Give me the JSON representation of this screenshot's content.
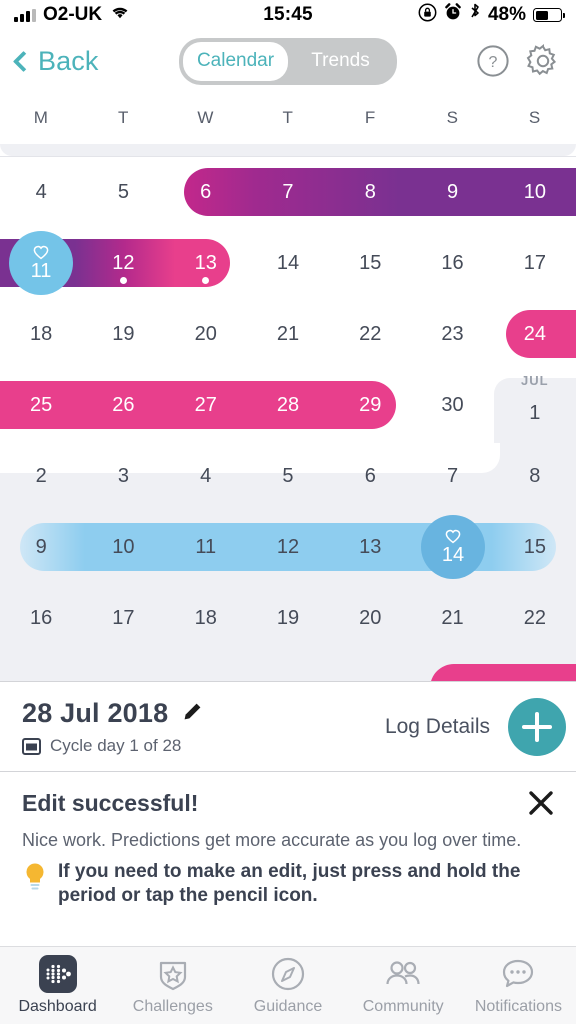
{
  "status_bar": {
    "carrier": "O2-UK",
    "time": "15:45",
    "battery_pct": "48%",
    "icons": [
      "signal-icon",
      "wifi-icon",
      "rotation-lock-icon",
      "alarm-icon",
      "bluetooth-icon",
      "battery-icon"
    ]
  },
  "header": {
    "back_label": "Back",
    "segments": [
      {
        "label": "Calendar",
        "active": true
      },
      {
        "label": "Trends",
        "active": false
      }
    ],
    "help_icon": "help-icon",
    "settings_icon": "gear-icon",
    "accent_teal": "#4cb3ba"
  },
  "calendar": {
    "weekdays": [
      "M",
      "T",
      "W",
      "T",
      "F",
      "S",
      "S"
    ],
    "colors": {
      "period_pink": "#e83f8c",
      "period_purple": "#7a3191",
      "fertile_blue": "#8ecdef",
      "ovulation_blue": "#74c4e8",
      "next_month_bg": "#eff0f4",
      "day_text": "#454b58"
    },
    "rows": [
      {
        "days": [
          {
            "num": "4"
          },
          {
            "num": "5"
          },
          {
            "num": "6"
          },
          {
            "num": "7"
          },
          {
            "num": "8"
          },
          {
            "num": "9"
          },
          {
            "num": "10"
          }
        ]
      },
      {
        "days": [
          {
            "num": "11"
          },
          {
            "num": "12"
          },
          {
            "num": "13"
          },
          {
            "num": "14"
          },
          {
            "num": "15"
          },
          {
            "num": "16"
          },
          {
            "num": "17"
          }
        ]
      },
      {
        "days": [
          {
            "num": "18"
          },
          {
            "num": "19"
          },
          {
            "num": "20"
          },
          {
            "num": "21"
          },
          {
            "num": "22"
          },
          {
            "num": "23"
          },
          {
            "num": "24"
          }
        ]
      },
      {
        "days": [
          {
            "num": "25"
          },
          {
            "num": "26"
          },
          {
            "num": "27"
          },
          {
            "num": "28"
          },
          {
            "num": "29"
          },
          {
            "num": "30"
          },
          {
            "num": "1",
            "month": "JUL"
          }
        ]
      },
      {
        "days": [
          {
            "num": "2"
          },
          {
            "num": "3"
          },
          {
            "num": "4"
          },
          {
            "num": "5"
          },
          {
            "num": "6"
          },
          {
            "num": "7"
          },
          {
            "num": "8"
          }
        ]
      },
      {
        "days": [
          {
            "num": "9"
          },
          {
            "num": "10"
          },
          {
            "num": "11"
          },
          {
            "num": "12"
          },
          {
            "num": "13"
          },
          {
            "num": "14"
          },
          {
            "num": "15"
          }
        ]
      },
      {
        "days": [
          {
            "num": "16"
          },
          {
            "num": "17"
          },
          {
            "num": "18"
          },
          {
            "num": "19"
          },
          {
            "num": "20"
          },
          {
            "num": "21"
          },
          {
            "num": "22"
          }
        ]
      }
    ]
  },
  "detail": {
    "date": "28 Jul 2018",
    "edit_icon": "pencil-icon",
    "calendar_icon": "calendar-icon",
    "cycle_day": "Cycle day 1 of 28",
    "log_details_label": "Log Details",
    "add_icon": "plus-icon",
    "add_button_color": "#3fa5ae"
  },
  "message": {
    "title": "Edit successful!",
    "close_icon": "close-icon",
    "body": "Nice work. Predictions get more accurate as you log over time.",
    "tip_icon": "lightbulb-icon",
    "tip": "If you need to make an edit, just press and hold the period or tap the pencil icon."
  },
  "tabbar": {
    "items": [
      {
        "label": "Dashboard",
        "icon": "fitbit-dots-icon",
        "active": true
      },
      {
        "label": "Challenges",
        "icon": "shield-star-icon",
        "active": false
      },
      {
        "label": "Guidance",
        "icon": "compass-icon",
        "active": false
      },
      {
        "label": "Community",
        "icon": "people-icon",
        "active": false
      },
      {
        "label": "Notifications",
        "icon": "speech-bubble-icon",
        "active": false
      }
    ]
  }
}
